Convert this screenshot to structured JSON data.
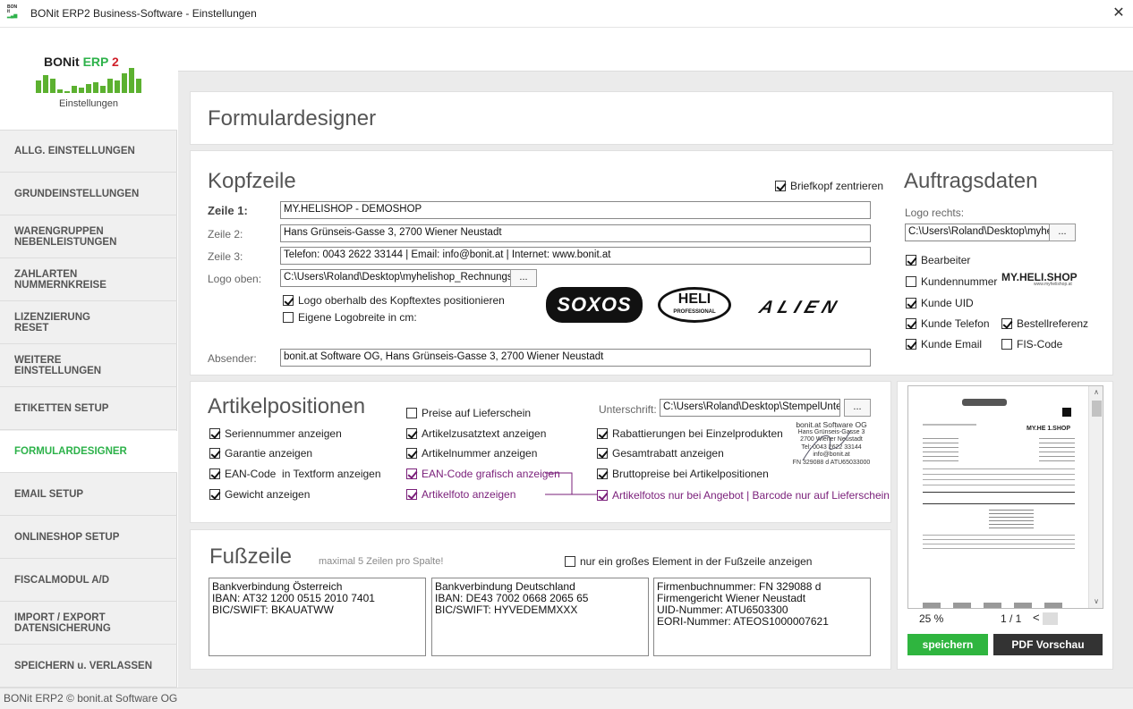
{
  "window": {
    "title": "BONit ERP2 Business-Software - Einstellungen",
    "icon_text": "BONit ERP2",
    "close": "✕"
  },
  "brand": {
    "name_a": "BONit",
    "name_b": "ERP",
    "name_c": "2",
    "subtitle": "Einstellungen",
    "colors": {
      "green": "#2db24a",
      "red": "#d0202a"
    }
  },
  "nav": [
    {
      "label": "ALLG. EINSTELLUNGEN"
    },
    {
      "label": "GRUNDEINSTELLUNGEN"
    },
    {
      "label": "WARENGRUPPEN\nNEBENLEISTUNGEN"
    },
    {
      "label": "ZAHLARTEN\nNUMMERNKREISE"
    },
    {
      "label": "LIZENZIERUNG\nRESET"
    },
    {
      "label": "WEITERE\nEINSTELLUNGEN"
    },
    {
      "label": "ETIKETTEN SETUP"
    },
    {
      "label": "FORMULARDESIGNER",
      "active": true
    },
    {
      "label": "EMAIL SETUP"
    },
    {
      "label": "ONLINESHOP SETUP"
    },
    {
      "label": "FISCALMODUL A/D"
    },
    {
      "label": "IMPORT / EXPORT\nDATENSICHERUNG"
    },
    {
      "label": "SPEICHERN u. VERLASSEN"
    }
  ],
  "page_title": "Formulardesigner",
  "kopf": {
    "title": "Kopfzeile",
    "center_label": "Briefkopf zentrieren",
    "z1_label": "Zeile 1:",
    "z1_value": "MY.HELISHOP - DEMOSHOP",
    "z2_label": "Zeile 2:",
    "z2_value": "Hans Grünseis-Gasse 3, 2700 Wiener Neustadt",
    "z3_label": "Zeile 3:",
    "z3_value": "Telefon: 0043 2622 33144 | Email: info@bonit.at | Internet: www.bonit.at",
    "logo_label": "Logo oben:",
    "logo_value": "C:\\Users\\Roland\\Desktop\\myhelishop_RechnungsB",
    "browse": "...",
    "logo_pos": "Logo oberhalb des Kopftextes positionieren",
    "logo_width": "Eigene Logobreite in cm:",
    "absender_label": "Absender:",
    "absender_value": "bonit.at Software OG, Hans Grünseis-Gasse 3, 2700 Wiener Neustadt",
    "logos": {
      "a": "SOXOS",
      "b": "HELI",
      "b_sub": "PROFESSIONAL",
      "c": "ALIEN"
    }
  },
  "auftrag": {
    "title": "Auftragsdaten",
    "logo_right_label": "Logo rechts:",
    "logo_right_value": "C:\\Users\\Roland\\Desktop\\myhelishop",
    "browse": "...",
    "logo": "MY.HELI.SHOP",
    "logo_sub": "www.myhelishop.at",
    "checks": {
      "bearbeiter": "Bearbeiter",
      "kundennummer": "Kundennummer",
      "kunde_uid": "Kunde UID",
      "kunde_telefon": "Kunde Telefon",
      "bestellref": "Bestellreferenz",
      "kunde_email": "Kunde Email",
      "fis": "FIS-Code"
    }
  },
  "artikel": {
    "title": "Artikelpositionen",
    "unterschrift_label": "Unterschrift:",
    "unterschrift_value": "C:\\Users\\Roland\\Desktop\\StempelUnter",
    "browse": "...",
    "checks": {
      "preise_ls": "Preise auf Lieferschein",
      "seriennr": "Seriennummer anzeigen",
      "zusatztext": "Artikelzusatztext anzeigen",
      "rabatt_einzel": "Rabattierungen bei Einzelprodukten",
      "garantie": "Garantie anzeigen",
      "artnr": "Artikelnummer anzeigen",
      "gesamtrabatt": "Gesamtrabatt anzeigen",
      "ean_text": "EAN-Code  in Textform anzeigen",
      "ean_grafisch": "EAN-Code grafisch anzeigen",
      "brutto": "Bruttopreise bei Artikelpositionen",
      "gewicht": "Gewicht anzeigen",
      "artikelfoto": "Artikelfoto anzeigen",
      "fotos_angebot": "Artikelfotos nur bei Angebot | Barcode nur auf Lieferschein"
    },
    "stamp": [
      "bonit.at Software OG",
      "Hans Grünseis-Gasse 3",
      "2700 Wiener Neustadt",
      "Tel: 0043 2622 33144",
      "info@bonit.at",
      "FN 329088 d  ATU65033000"
    ]
  },
  "fuss": {
    "title": "Fußzeile",
    "hint": "maximal 5 Zeilen pro Spalte!",
    "big_element": "nur ein großes Element in der Fußzeile anzeigen",
    "col1": "Bankverbindung Österreich\nIBAN: AT32 1200 0515 2010 7401\nBIC/SWIFT: BKAUATWW",
    "col2": "Bankverbindung Deutschland\nIBAN: DE43 7002 0668 2065 65\nBIC/SWIFT: HYVEDEMMXXX",
    "col3": "Firmenbuchnummer: FN 329088 d\nFirmengericht Wiener Neustadt\nUID-Nummer: ATU6503300\nEORI-Nummer: ATEOS1000007621"
  },
  "preview": {
    "zoom": "25 %",
    "page": "1 / 1",
    "prev": "<",
    "logo": "MY.HE 1.SHOP",
    "save": "speichern",
    "pdf": "PDF Vorschau",
    "scroll_up": "∧",
    "scroll_down": "∨"
  },
  "status": "BONit ERP2 © bonit.at Software OG"
}
